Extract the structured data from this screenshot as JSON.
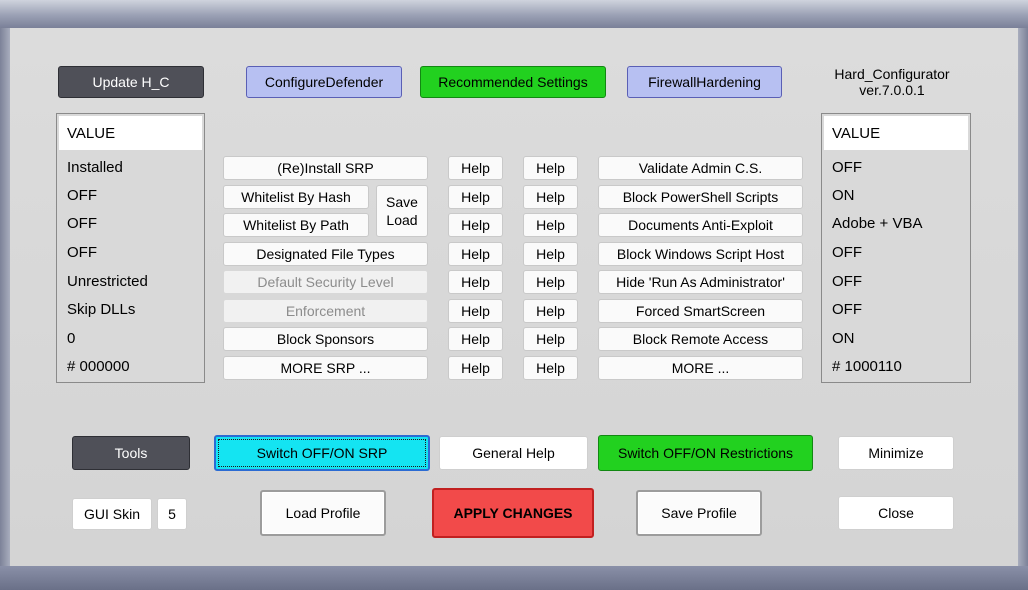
{
  "top": {
    "update_label": "Update H_C",
    "configure_defender_label": "ConfigureDefender",
    "recommended_label": "Recommended Settings",
    "firewall_label": "FirewallHardening",
    "app_name": "Hard_Configurator",
    "version": "ver.7.0.0.1"
  },
  "left_values": {
    "header": "VALUE",
    "items": [
      "Installed",
      "OFF",
      "OFF",
      "OFF",
      "Unrestricted",
      "Skip DLLs",
      "0",
      "# 000000"
    ]
  },
  "srp": {
    "reinstall": "(Re)Install SRP",
    "whitelist_hash": "Whitelist By Hash",
    "whitelist_path": "Whitelist By Path",
    "save_load_1": "Save",
    "save_load_2": "Load",
    "designated": "Designated File Types",
    "default_security": "Default Security Level",
    "enforcement": "Enforcement",
    "block_sponsors": "Block Sponsors",
    "more_srp": "MORE SRP ..."
  },
  "help_label": "Help",
  "restrictions": {
    "items": [
      "Validate Admin C.S.",
      "Block PowerShell Scripts",
      "Documents Anti-Exploit",
      "Block Windows Script Host",
      "Hide  'Run As Administrator'",
      "Forced SmartScreen",
      "Block Remote Access",
      "MORE ..."
    ]
  },
  "right_values": {
    "header": "VALUE",
    "items": [
      "OFF",
      "ON",
      "Adobe + VBA",
      "OFF",
      "OFF",
      "OFF",
      "ON",
      "# 1000110"
    ]
  },
  "bottom": {
    "tools": "Tools",
    "switch_srp": "Switch OFF/ON SRP",
    "general_help": "General Help",
    "switch_restrictions": "Switch OFF/ON Restrictions",
    "minimize": "Minimize",
    "gui_skin": "GUI Skin",
    "skin_number": "5",
    "load_profile": "Load Profile",
    "apply": "APPLY CHANGES",
    "save_profile": "Save Profile",
    "close": "Close"
  }
}
